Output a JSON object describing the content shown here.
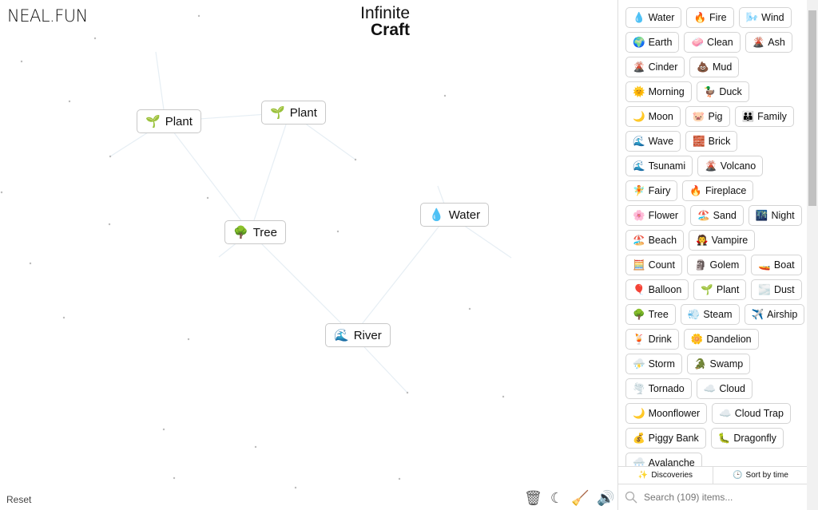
{
  "logo": "NEAL.FUN",
  "title": {
    "line1": "Infinite",
    "line2": "Craft"
  },
  "canvas": {
    "items": [
      {
        "emoji": "🌱",
        "label": "Plant"
      },
      {
        "emoji": "🌱",
        "label": "Plant"
      },
      {
        "emoji": "🌳",
        "label": "Tree"
      },
      {
        "emoji": "💧",
        "label": "Water"
      },
      {
        "emoji": "🌊",
        "label": "River"
      }
    ]
  },
  "reset_label": "Reset",
  "tools": {
    "trash": "🗑",
    "dark_mode": "☾",
    "clear": "🧹",
    "sound": "🔊"
  },
  "sidebar": {
    "items": [
      {
        "emoji": "💧",
        "label": "Water"
      },
      {
        "emoji": "🔥",
        "label": "Fire"
      },
      {
        "emoji": "🌬️",
        "label": "Wind"
      },
      {
        "emoji": "🌍",
        "label": "Earth"
      },
      {
        "emoji": "🧼",
        "label": "Clean"
      },
      {
        "emoji": "🌋",
        "label": "Ash"
      },
      {
        "emoji": "🌋",
        "label": "Cinder"
      },
      {
        "emoji": "💩",
        "label": "Mud"
      },
      {
        "emoji": "🌞",
        "label": "Morning"
      },
      {
        "emoji": "🦆",
        "label": "Duck"
      },
      {
        "emoji": "🌙",
        "label": "Moon"
      },
      {
        "emoji": "🐷",
        "label": "Pig"
      },
      {
        "emoji": "👪",
        "label": "Family"
      },
      {
        "emoji": "🌊",
        "label": "Wave"
      },
      {
        "emoji": "🧱",
        "label": "Brick"
      },
      {
        "emoji": "🌊",
        "label": "Tsunami"
      },
      {
        "emoji": "🌋",
        "label": "Volcano"
      },
      {
        "emoji": "🧚",
        "label": "Fairy"
      },
      {
        "emoji": "🔥",
        "label": "Fireplace"
      },
      {
        "emoji": "🌸",
        "label": "Flower"
      },
      {
        "emoji": "🏖️",
        "label": "Sand"
      },
      {
        "emoji": "🌃",
        "label": "Night"
      },
      {
        "emoji": "🏖️",
        "label": "Beach"
      },
      {
        "emoji": "🧛",
        "label": "Vampire"
      },
      {
        "emoji": "🧮",
        "label": "Count"
      },
      {
        "emoji": "🗿",
        "label": "Golem"
      },
      {
        "emoji": "🚤",
        "label": "Boat"
      },
      {
        "emoji": "🎈",
        "label": "Balloon"
      },
      {
        "emoji": "🌱",
        "label": "Plant"
      },
      {
        "emoji": "🌫️",
        "label": "Dust"
      },
      {
        "emoji": "🌳",
        "label": "Tree"
      },
      {
        "emoji": "💨",
        "label": "Steam"
      },
      {
        "emoji": "✈️",
        "label": "Airship"
      },
      {
        "emoji": "🍹",
        "label": "Drink"
      },
      {
        "emoji": "🌼",
        "label": "Dandelion"
      },
      {
        "emoji": "⛈️",
        "label": "Storm"
      },
      {
        "emoji": "🐊",
        "label": "Swamp"
      },
      {
        "emoji": "🌪️",
        "label": "Tornado"
      },
      {
        "emoji": "☁️",
        "label": "Cloud"
      },
      {
        "emoji": "🌙",
        "label": "Moonflower"
      },
      {
        "emoji": "☁️",
        "label": "Cloud Trap"
      },
      {
        "emoji": "💰",
        "label": "Piggy Bank"
      },
      {
        "emoji": "🐛",
        "label": "Dragonfly"
      },
      {
        "emoji": "🌨️",
        "label": "Avalanche"
      }
    ]
  },
  "tabs": {
    "discoveries": "Discoveries",
    "sort": "Sort by time",
    "discoveries_icon": "✨",
    "sort_icon": "🕒"
  },
  "search": {
    "placeholder": "Search (109) items..."
  }
}
